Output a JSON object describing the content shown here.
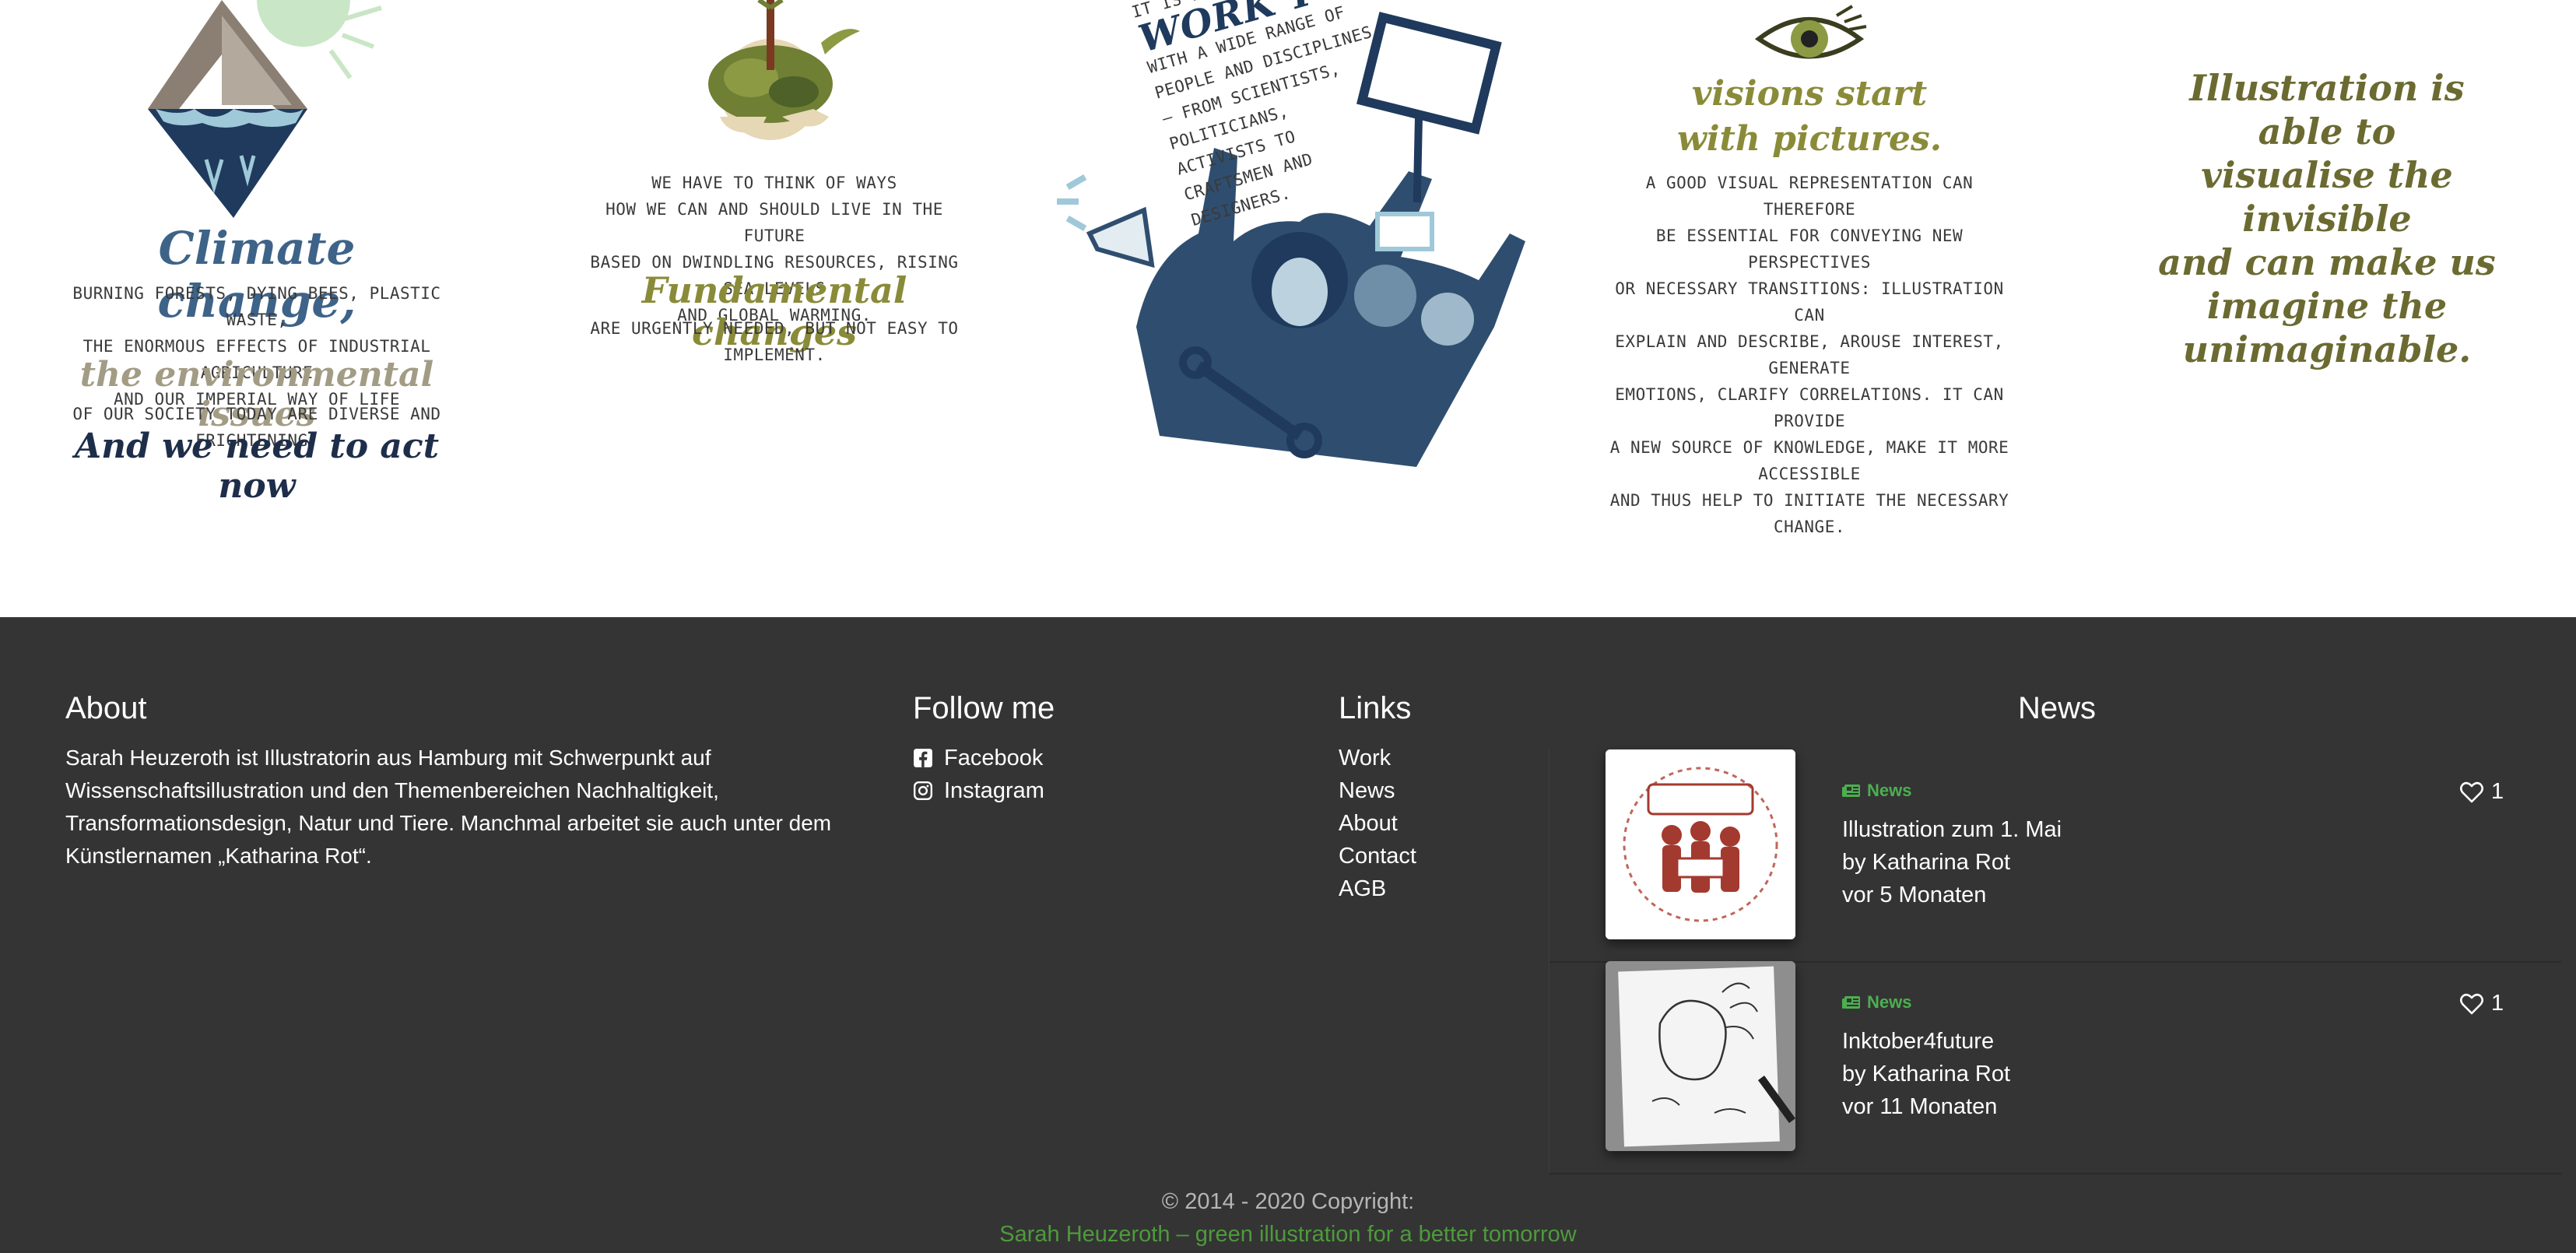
{
  "illustration": {
    "panel1": {
      "title": "Climate change,",
      "body1_lines": [
        "Burning forests, dying bees, plastic waste,",
        "the enormous effects of industrial agriculture",
        "and our imperial way of life"
      ],
      "subtitle": "the environmental issues",
      "body2": "of our society today are diverse and frightening.",
      "tagline": "And we need to act now"
    },
    "panel2": {
      "body1_lines": [
        "We have to think of ways",
        "how we can and should live in the future",
        "based on dwindling resources, rising sea levels",
        "and global warming."
      ],
      "title": "Fundamental changes",
      "body2": "are urgently needed, but not easy to implement."
    },
    "panel3": {
      "line_top": "It is ever",
      "work": "Work tog",
      "lines": [
        "with a wide range of",
        "people and disciplines",
        "– from scientists,",
        "politicians,",
        "activists to",
        "craftsmen and",
        "designers."
      ]
    },
    "panel4": {
      "title_lines": [
        "visions start",
        "with pictures."
      ],
      "body_lines": [
        "A good visual representation can therefore",
        "be essential for conveying new perspectives",
        "or necessary transitions: illustration can",
        "explain and describe, arouse interest, generate",
        "emotions, clarify correlations. It can provide",
        "a new source of knowledge, make it more accessible",
        "and thus help to initiate the necessary change."
      ]
    },
    "panel5": {
      "lines": [
        "Illustration is able to",
        "visualise the invisible",
        "and can make us",
        "imagine the",
        "unimaginable."
      ]
    }
  },
  "footer": {
    "about": {
      "heading": "About",
      "text": "Sarah Heuzeroth ist Illustratorin aus Hamburg mit Schwerpunkt auf Wissenschaftsillustration und den Themenbereichen Nachhaltigkeit, Transformationsdesign, Natur und Tiere. Manchmal arbeitet sie auch unter dem Künstlernamen „Katharina Rot“."
    },
    "follow": {
      "heading": "Follow me",
      "items": [
        {
          "label": "Facebook",
          "icon": "facebook-icon"
        },
        {
          "label": "Instagram",
          "icon": "instagram-icon"
        }
      ]
    },
    "links": {
      "heading": "Links",
      "items": [
        "Work",
        "News",
        "About",
        "Contact",
        "AGB"
      ]
    },
    "news": {
      "heading": "News",
      "items": [
        {
          "category": "News",
          "title": "Illustration zum 1. Mai",
          "by": "by  Katharina Rot",
          "date": "vor 5 Monaten",
          "likes": "1"
        },
        {
          "category": "News",
          "title": "Inktober4future",
          "by": "by  Katharina Rot",
          "date": "vor 11 Monaten",
          "likes": "1"
        }
      ]
    },
    "copyright": "© 2014 - 2020 Copyright:",
    "copyright_link": "Sarah Heuzeroth – green illustration for a better tomorrow"
  },
  "colors": {
    "footer_bg": "#343434",
    "accent_green": "#4caf50",
    "link_green": "#4e9a3c",
    "navy": "#1e2e4a",
    "olive": "#8a8b39"
  }
}
